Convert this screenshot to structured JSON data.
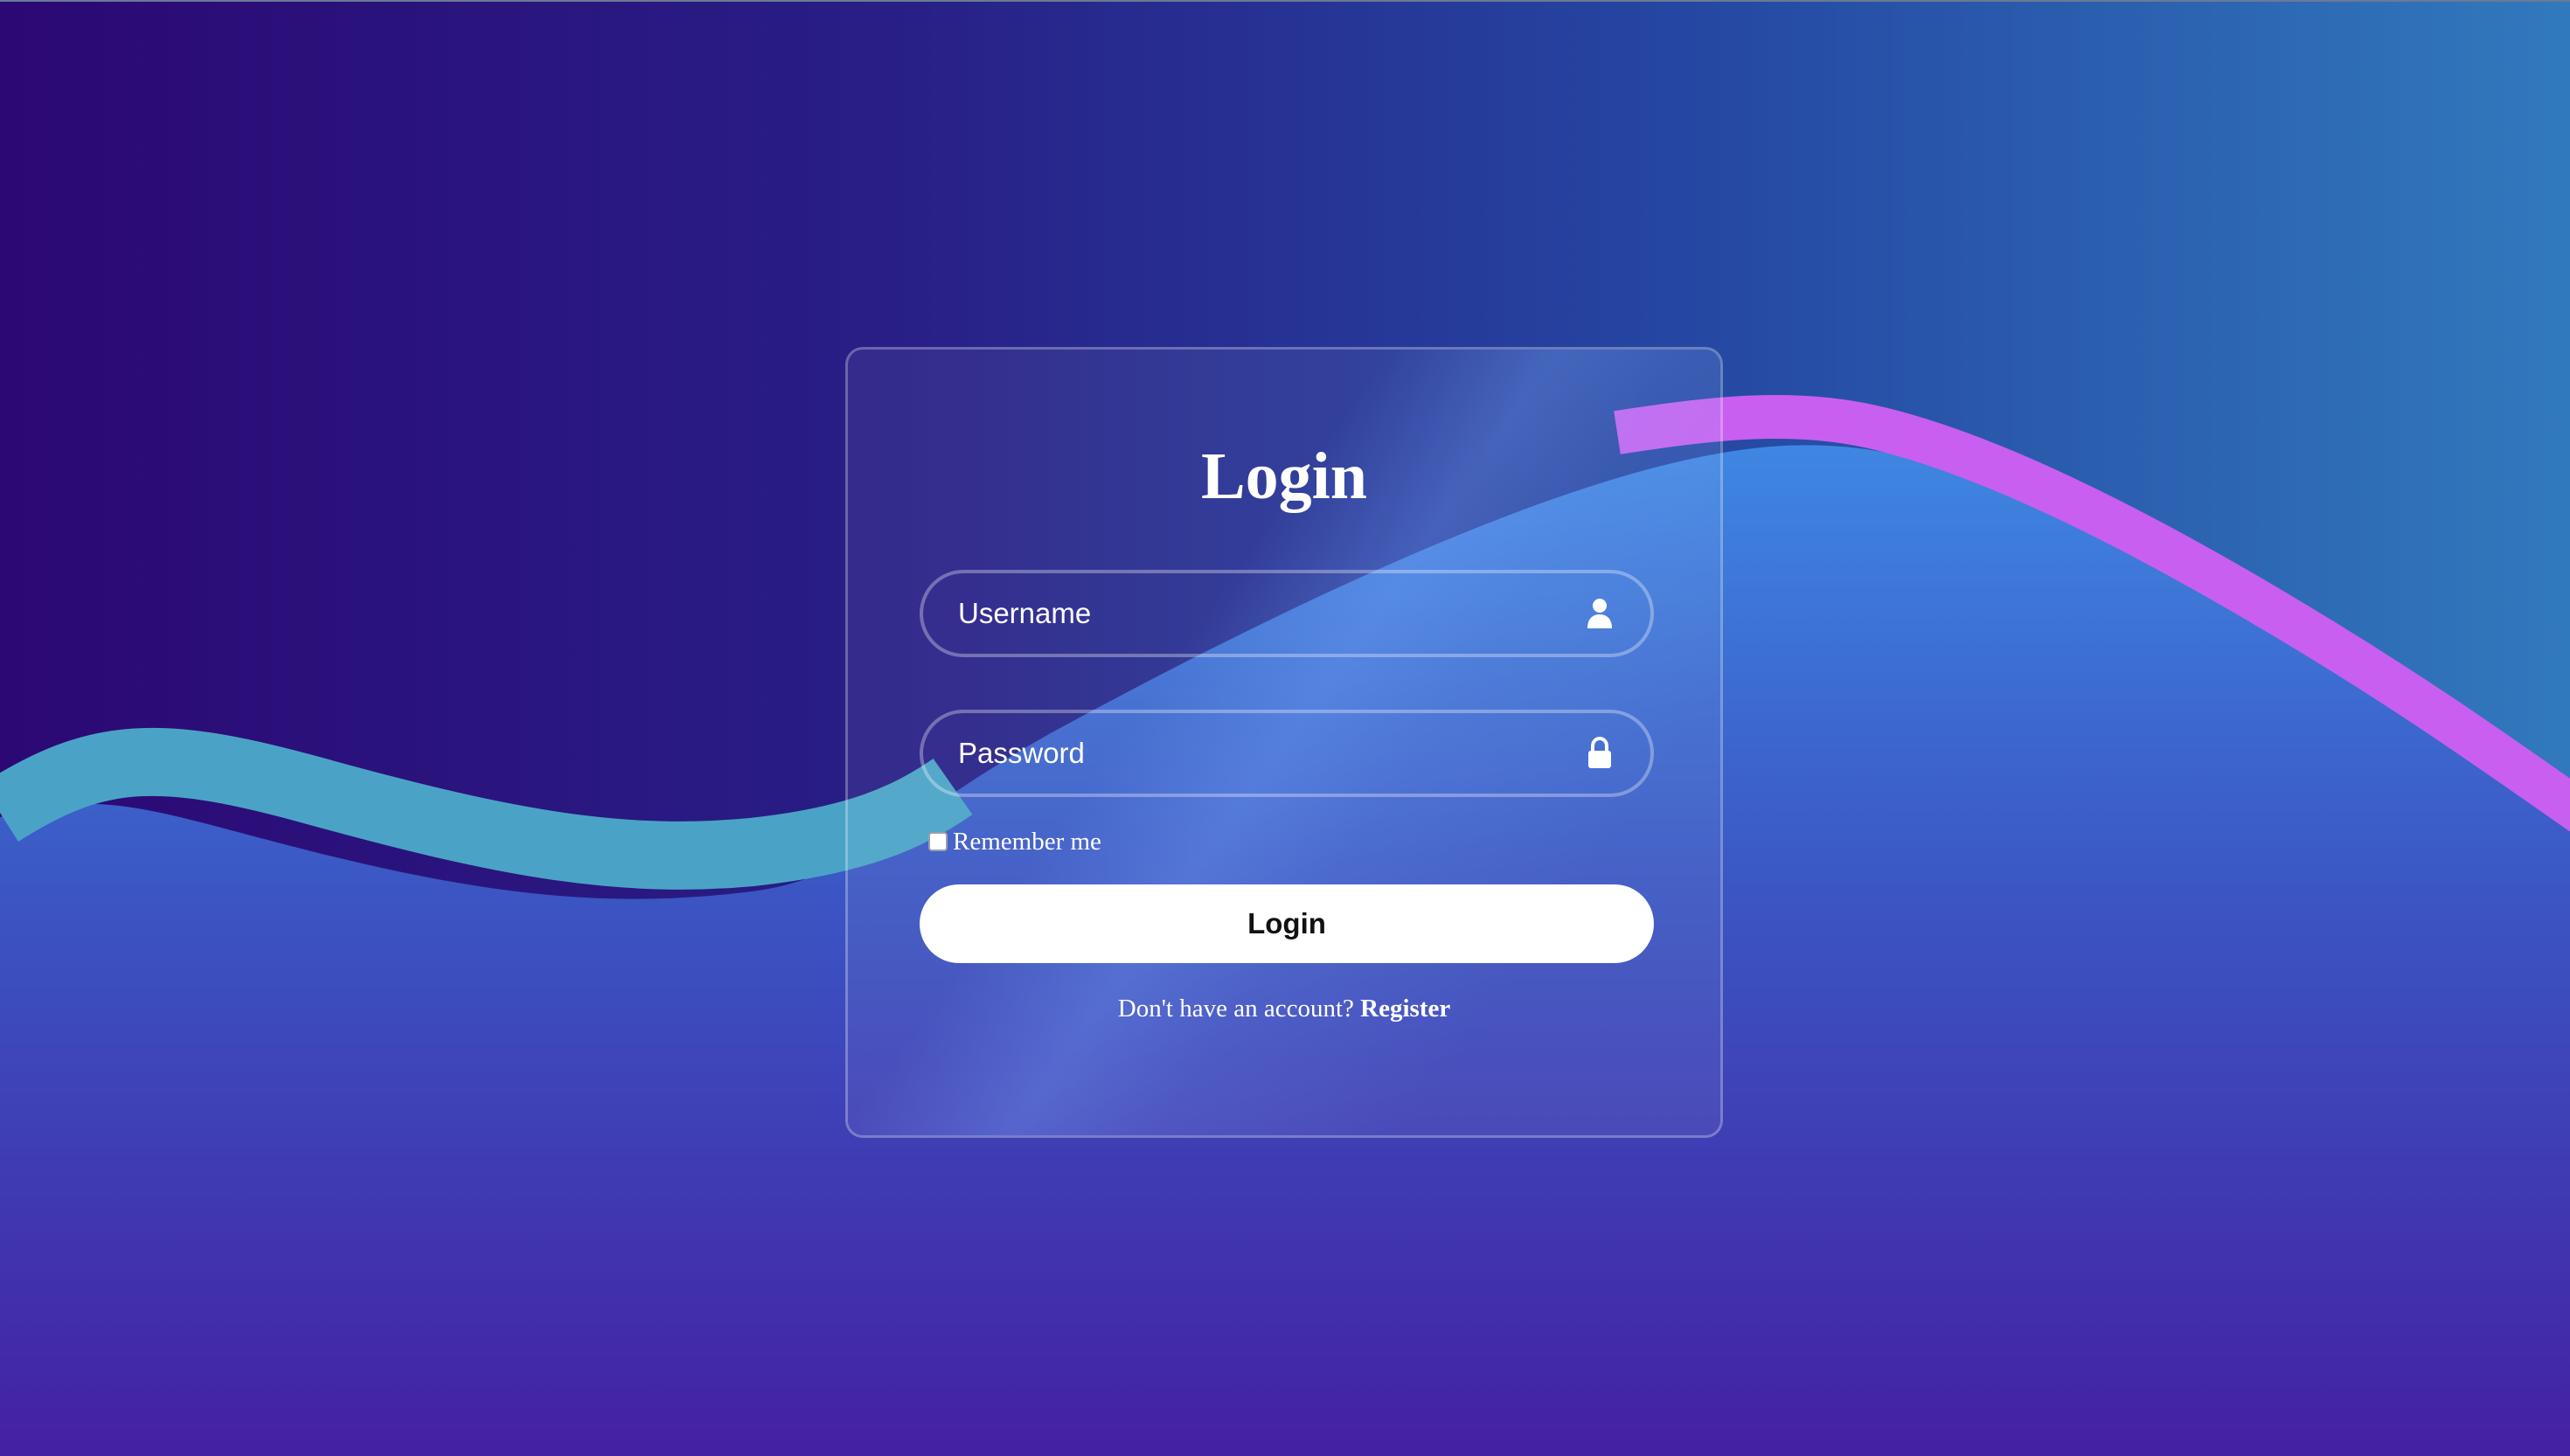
{
  "page": {
    "background_top_left": "#2c0874",
    "background_top_right": "#2f78bc",
    "background_bottom": "#4520a0",
    "wave_left_color": "#4aa3c6",
    "wave_right_color": "#c85ff0",
    "wave_fill_color": "#3e84e0"
  },
  "login_form": {
    "title": "Login",
    "username": {
      "placeholder": "Username",
      "value": "",
      "icon": "user-icon"
    },
    "password": {
      "placeholder": "Password",
      "value": "",
      "icon": "lock-icon"
    },
    "remember_me": {
      "label": "Remember me",
      "checked": false
    },
    "submit_label": "Login",
    "register_prompt": "Don't have an account?",
    "register_link": "Register"
  }
}
